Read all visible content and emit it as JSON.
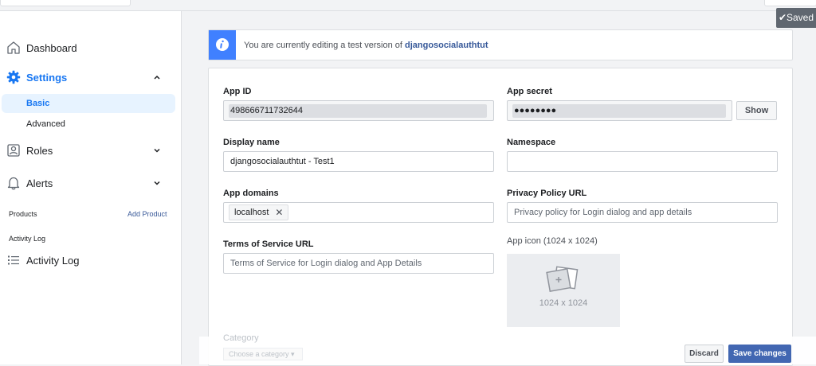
{
  "toast": {
    "saved": "✔Saved"
  },
  "sidebar": {
    "dashboard": {
      "label": "Dashboard",
      "icon": "home-icon"
    },
    "settings": {
      "label": "Settings",
      "icon": "gear-icon"
    },
    "settings_sub": [
      {
        "label": "Basic",
        "selected": true
      },
      {
        "label": "Advanced",
        "selected": false
      }
    ],
    "roles": {
      "label": "Roles",
      "icon": "person-icon"
    },
    "alerts": {
      "label": "Alerts",
      "icon": "bell-icon"
    },
    "products": {
      "heading": "Products",
      "add_label": "Add Product"
    },
    "activity": {
      "heading": "Activity Log",
      "label": "Activity Log",
      "icon": "list-icon"
    }
  },
  "banner": {
    "prefix": "You are currently editing a test version of ",
    "app_name": "djangosocialauthtut"
  },
  "form": {
    "app_id": {
      "label": "App ID",
      "value": "498666711732644"
    },
    "app_secret": {
      "label": "App secret",
      "value": "●●●●●●●●",
      "show_label": "Show"
    },
    "display_name": {
      "label": "Display name",
      "value": "djangosocialauthtut - Test1"
    },
    "namespace": {
      "label": "Namespace",
      "value": ""
    },
    "app_domains": {
      "label": "App domains",
      "tokens": [
        "localhost"
      ]
    },
    "privacy_url": {
      "label": "Privacy Policy URL",
      "placeholder": "Privacy policy for Login dialog and app details"
    },
    "tos_url": {
      "label": "Terms of Service URL",
      "placeholder": "Terms of Service for Login dialog and App Details"
    },
    "app_icon": {
      "label": "App icon (1024 x 1024)",
      "dimensions": "1024 x 1024"
    },
    "category": {
      "label": "Category",
      "placeholder": "Choose a category ▾"
    }
  },
  "footer": {
    "discard_label": "Discard",
    "save_label": "Save changes"
  },
  "colors": {
    "accent": "#1877f2",
    "primary_button": "#4267b2",
    "banner_icon_bg": "#4080ff"
  }
}
